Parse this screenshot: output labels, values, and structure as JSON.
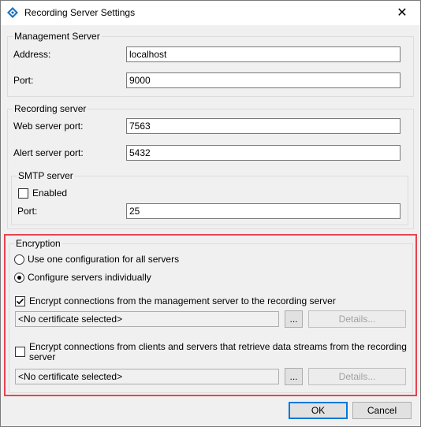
{
  "window": {
    "title": "Recording Server Settings",
    "close_glyph": "✕",
    "app_icon": "diamond-icon"
  },
  "management": {
    "legend": "Management Server",
    "address_label": "Address:",
    "address_value": "localhost",
    "port_label": "Port:",
    "port_value": "9000"
  },
  "recording": {
    "legend": "Recording server",
    "web_label": "Web server port:",
    "web_value": "7563",
    "alert_label": "Alert server port:",
    "alert_value": "5432"
  },
  "smtp": {
    "legend": "SMTP server",
    "enabled_label": "Enabled",
    "enabled_checked": false,
    "port_label": "Port:",
    "port_value": "25"
  },
  "encryption": {
    "legend": "Encryption",
    "radio_all": "Use one configuration for all servers",
    "radio_individual": "Configure servers individually",
    "selected_radio": "individual",
    "mgmt_check_label": "Encrypt connections from the management server to the recording server",
    "mgmt_checked": true,
    "mgmt_cert": "<No certificate selected>",
    "clients_check_label_line1": "Encrypt connections from clients and servers that retrieve data streams from the recording",
    "clients_check_label_line2": "server",
    "clients_checked": false,
    "clients_cert": "<No certificate selected>",
    "browse_label": "...",
    "details_label": "Details...",
    "highlight_color": "#e74450"
  },
  "footer": {
    "ok_label": "OK",
    "cancel_label": "Cancel"
  }
}
